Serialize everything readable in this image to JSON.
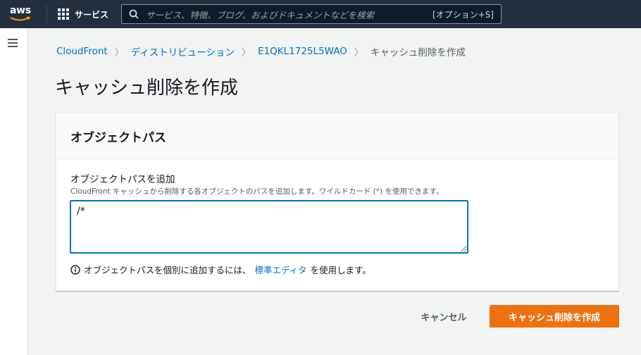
{
  "topnav": {
    "logo_text": "aws",
    "services_label": "サービス",
    "search_placeholder": "サービス、特徴、ブログ、およびドキュメントなどを検索",
    "search_shortcut": "[オプション+S]"
  },
  "breadcrumb": [
    {
      "label": "CloudFront"
    },
    {
      "label": "ディストリビューション"
    },
    {
      "label": "E1QKL1725L5WAO"
    },
    {
      "label": "キャッシュ削除を作成"
    }
  ],
  "page_title": "キャッシュ削除を作成",
  "panel": {
    "title": "オブジェクトパス",
    "field_label": "オブジェクトパスを追加",
    "field_description": "CloudFront キャッシュから削除する各オブジェクトのパスを追加します。ワイルドカード (*) を使用できます。",
    "field_value": "/*",
    "info_prefix": "オブジェクトパスを個別に追加するには、",
    "info_link": "標準エディタ",
    "info_suffix": "を使用します。"
  },
  "footer": {
    "cancel_label": "キャンセル",
    "submit_label": "キャッシュ削除を作成"
  },
  "colors": {
    "nav_bg": "#232f3e",
    "link": "#0073bb",
    "primary": "#ec7211",
    "focus_border": "#0073bb"
  }
}
